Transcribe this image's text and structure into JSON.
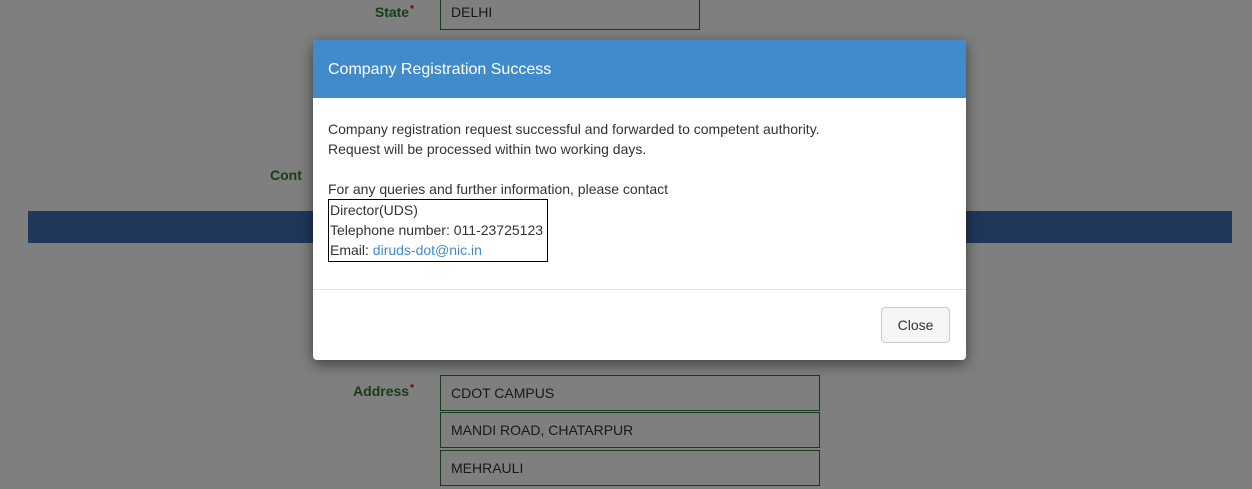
{
  "form": {
    "state_label": "State",
    "state_value": "DELHI",
    "contact_label_fragment": "Cont",
    "address_label": "Address",
    "address_line1": "CDOT CAMPUS",
    "address_line2": "MANDI ROAD, CHATARPUR",
    "address_line3": "MEHRAULI"
  },
  "modal": {
    "title": "Company Registration Success",
    "line1": "Company registration request successful and forwarded to competent authority.",
    "line2": "Request will be processed within two working days.",
    "line3": "For any queries and further information, please contact",
    "contact": {
      "name": "Director(UDS)",
      "telephone": "Telephone number: 011-23725123",
      "email_label": "Email: ",
      "email": "diruds-dot@nic.in"
    },
    "close_label": "Close"
  }
}
